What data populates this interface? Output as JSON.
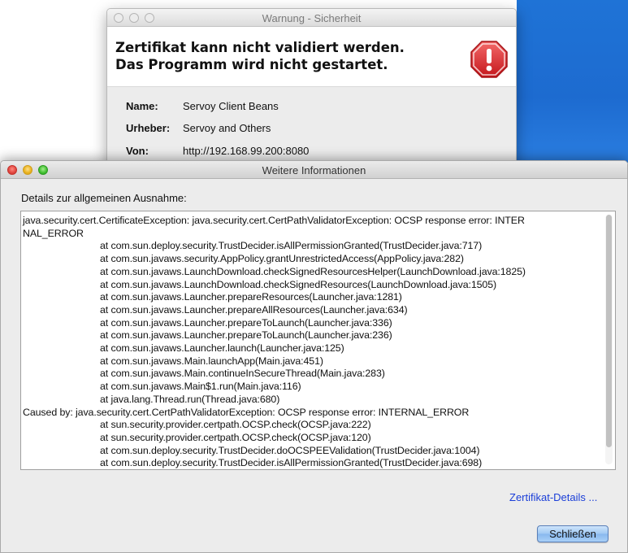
{
  "back_window": {
    "title": "Warnung - Sicherheit",
    "message_line1": "Zertifikat kann nicht validiert werden.",
    "message_line2": "Das Programm wird nicht gestartet.",
    "icon": "warning-stop-icon",
    "fields": [
      {
        "label": "Name:",
        "value": "Servoy Client Beans"
      },
      {
        "label": "Urheber:",
        "value": "Servoy and Others"
      },
      {
        "label": "Von:",
        "value": "http://192.168.99.200:8080"
      }
    ]
  },
  "front_window": {
    "title": "Weitere Informationen",
    "details_label": "Details zur allgemeinen Ausnahme:",
    "details_lines": [
      "java.security.cert.CertificateException: java.security.cert.CertPathValidatorException: OCSP response error: INTER",
      "NAL_ERROR",
      "\t\t\tat com.sun.deploy.security.TrustDecider.isAllPermissionGranted(TrustDecider.java:717)",
      "\t\t\tat com.sun.javaws.security.AppPolicy.grantUnrestrictedAccess(AppPolicy.java:282)",
      "\t\t\tat com.sun.javaws.LaunchDownload.checkSignedResourcesHelper(LaunchDownload.java:1825)",
      "\t\t\tat com.sun.javaws.LaunchDownload.checkSignedResources(LaunchDownload.java:1505)",
      "\t\t\tat com.sun.javaws.Launcher.prepareResources(Launcher.java:1281)",
      "\t\t\tat com.sun.javaws.Launcher.prepareAllResources(Launcher.java:634)",
      "\t\t\tat com.sun.javaws.Launcher.prepareToLaunch(Launcher.java:336)",
      "\t\t\tat com.sun.javaws.Launcher.prepareToLaunch(Launcher.java:236)",
      "\t\t\tat com.sun.javaws.Launcher.launch(Launcher.java:125)",
      "\t\t\tat com.sun.javaws.Main.launchApp(Main.java:451)",
      "\t\t\tat com.sun.javaws.Main.continueInSecureThread(Main.java:283)",
      "\t\t\tat com.sun.javaws.Main$1.run(Main.java:116)",
      "\t\t\tat java.lang.Thread.run(Thread.java:680)",
      "Caused by: java.security.cert.CertPathValidatorException: OCSP response error: INTERNAL_ERROR",
      "\t\t\tat sun.security.provider.certpath.OCSP.check(OCSP.java:222)",
      "\t\t\tat sun.security.provider.certpath.OCSP.check(OCSP.java:120)",
      "\t\t\tat com.sun.deploy.security.TrustDecider.doOCSPEEValidation(TrustDecider.java:1004)",
      "\t\t\tat com.sun.deploy.security.TrustDecider.isAllPermissionGranted(TrustDecider.java:698)"
    ],
    "certificate_link": "Zertifikat-Details ...",
    "close_button": "Schließen"
  },
  "colors": {
    "link": "#1a3ed8",
    "warning_red": "#d8262a",
    "desktop_blue": "#1f73d6"
  }
}
